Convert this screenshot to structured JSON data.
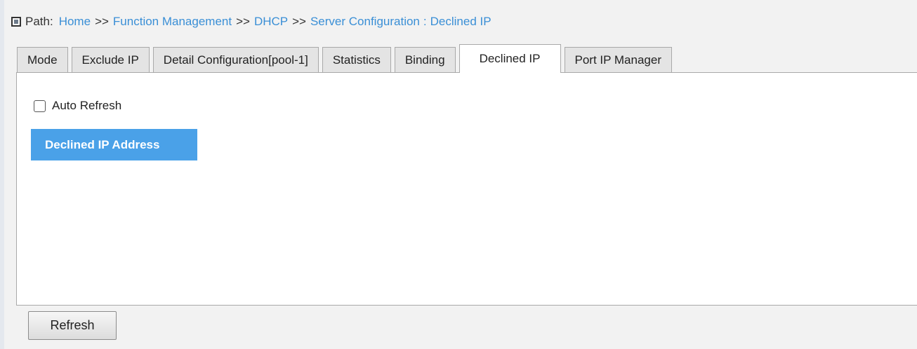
{
  "breadcrumb": {
    "label": "Path:",
    "items": [
      "Home",
      "Function Management",
      "DHCP",
      "Server Configuration"
    ],
    "separator": ">>",
    "current_sep": ":",
    "current": "Declined IP"
  },
  "tabs": [
    {
      "label": "Mode",
      "active": false
    },
    {
      "label": "Exclude IP",
      "active": false
    },
    {
      "label": "Detail Configuration[pool-1]",
      "active": false
    },
    {
      "label": "Statistics",
      "active": false
    },
    {
      "label": "Binding",
      "active": false
    },
    {
      "label": "Declined IP",
      "active": true
    },
    {
      "label": "Port IP Manager",
      "active": false
    }
  ],
  "panel": {
    "auto_refresh_label": "Auto Refresh",
    "auto_refresh_checked": false,
    "table_header": "Declined IP Address",
    "rows": []
  },
  "footer": {
    "refresh_label": "Refresh"
  },
  "colors": {
    "link": "#3a8fd6",
    "header_bg": "#4aa1e8"
  }
}
